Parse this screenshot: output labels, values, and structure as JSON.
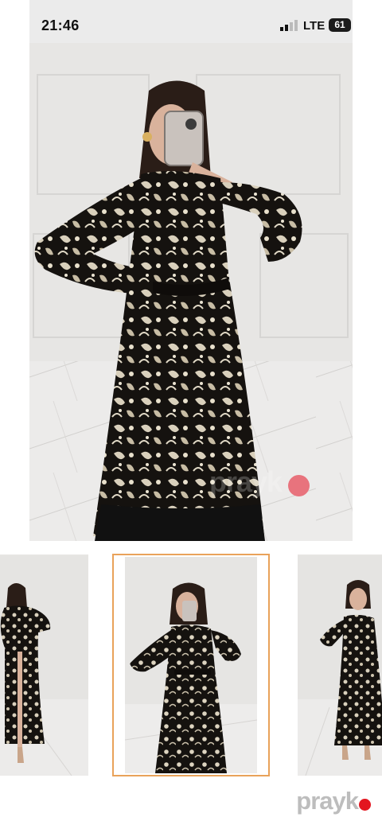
{
  "status_bar": {
    "time": "21:46",
    "network": "LTE",
    "battery": "61"
  },
  "viewer": {
    "close_icon": "close-icon",
    "watermark": "prayk"
  },
  "thumbnails": [
    {
      "name": "thumbnail-1",
      "selected": false
    },
    {
      "name": "thumbnail-2",
      "selected": true
    },
    {
      "name": "thumbnail-3",
      "selected": false
    }
  ],
  "brand": {
    "logo_text": "prayk",
    "dot_color": "#e3151f",
    "selected_border": "#e9a25a"
  }
}
